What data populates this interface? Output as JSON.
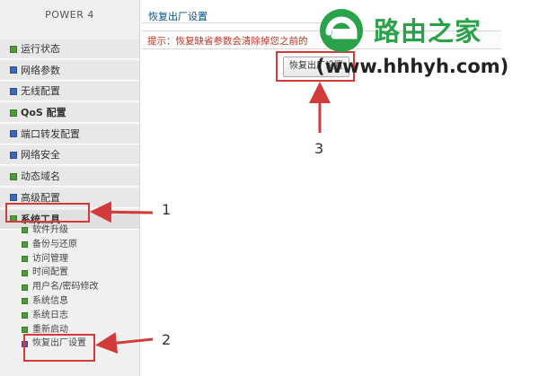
{
  "brand": "POWER 4",
  "menu": [
    {
      "label": "运行状态",
      "bullet": "green"
    },
    {
      "label": "网络参数",
      "bullet": "blue"
    },
    {
      "label": "无线配置",
      "bullet": "blue"
    },
    {
      "label": "QoS 配置",
      "bullet": "green"
    },
    {
      "label": "端口转发配置",
      "bullet": "blue"
    },
    {
      "label": "网络安全",
      "bullet": "blue"
    },
    {
      "label": "动态域名",
      "bullet": "green"
    },
    {
      "label": "高级配置",
      "bullet": "blue"
    },
    {
      "label": "系统工具",
      "bullet": "green"
    }
  ],
  "submenu": [
    {
      "label": "软件升级"
    },
    {
      "label": "备份与还原"
    },
    {
      "label": "访问管理"
    },
    {
      "label": "时间配置"
    },
    {
      "label": "用户名/密码修改"
    },
    {
      "label": "系统信息"
    },
    {
      "label": "系统日志"
    },
    {
      "label": "重新启动"
    },
    {
      "label": "恢复出厂设置"
    }
  ],
  "panel": {
    "title": "恢复出厂设置",
    "notice": "提示：恢复缺省参数会清除掉您之前的",
    "button_label": "恢复出厂设置"
  },
  "steps": [
    "1",
    "2",
    "3"
  ],
  "watermark": {
    "brand": "路由之家",
    "url": "(www.hhhyh.com)"
  },
  "colors": {
    "highlight": "#d33b3b",
    "watermark_green": "#2aa24a",
    "notice_red": "#c0392b"
  }
}
